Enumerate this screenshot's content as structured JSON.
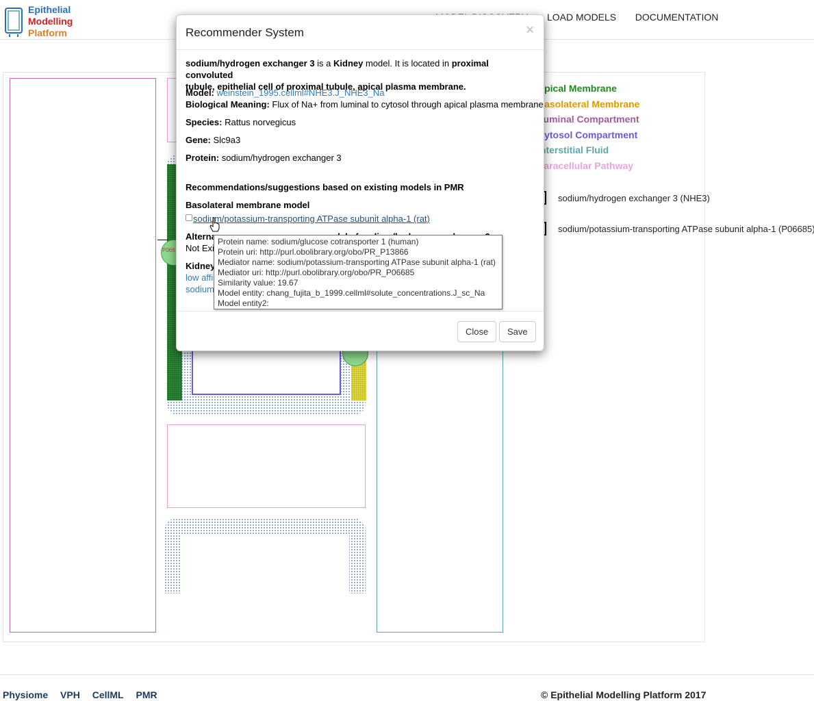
{
  "brand": {
    "line1": "Epithelial",
    "line2": "Modelling",
    "line3": "Platform"
  },
  "nav": {
    "items": [
      "MODEL DISCOVERY",
      "LOAD MODELS",
      "DOCUMENTATION"
    ]
  },
  "legend": {
    "items": [
      {
        "label": "Apical Membrane",
        "color": "#1e8a1e"
      },
      {
        "label": "Basolateral Membrane",
        "color": "#e09a00"
      },
      {
        "label": "Luminal Compartment",
        "color": "#a25aa0"
      },
      {
        "label": "Cytosol Compartment",
        "color": "#6a5ad6"
      },
      {
        "label": "Interstitial Fluid",
        "color": "#5aa8a8"
      },
      {
        "label": "Paracellular Pathway",
        "color": "#e6a6dc"
      }
    ]
  },
  "models": [
    {
      "label": "sodium/hydrogen exchanger 3 (NHE3)"
    },
    {
      "label": "sodium/potassium-transporting ATPase subunit alpha-1 (P06685)"
    }
  ],
  "diagram": {
    "transporter_label": "P066"
  },
  "modal": {
    "title": "Recommender System",
    "close_symbol": "×",
    "intro": {
      "name": "sodium/hydrogen exchanger 3",
      "is_a": " is a ",
      "organ": "Kidney",
      "located": " model. It is located in ",
      "location_line1": "proximal convoluted",
      "location_line2": "tubule, epithelial cell of proximal tubule, apical plasma membrane."
    },
    "model_label": "Model:",
    "model_link": "weinstein_1995.cellml#NHE3.J_NHE3_Na",
    "bio_label": "Biological Meaning:",
    "bio_value": "Flux of Na+ from luminal to cytosol through apical plasma membrane",
    "species_label": "Species:",
    "species_value": "Rattus norvegicus",
    "gene_label": "Gene:",
    "gene_value": "Slc9a3",
    "protein_label": "Protein:",
    "protein_value": "sodium/hydrogen exchanger 3",
    "recommendations_heading": "Recommendations/suggestions based on existing models in PMR",
    "basolateral_heading": "Basolateral membrane model",
    "basolateral_option": "sodium/potassium-transporting ATPase subunit alpha-1 (rat)",
    "alternative_heading_visible": "Alterna",
    "alternative_heading_tail": "model of sodium/hydrogen exchanger 3",
    "alternative_value_visible": "Not Exi",
    "kidney_heading_visible": "Kidney",
    "kidney_link1_visible": "low affi",
    "kidney_link2_visible": "sodium",
    "close_button": "Close",
    "save_button": "Save"
  },
  "tooltip": {
    "lines": [
      "Protein name: sodium/glucose cotransporter 1 (human)",
      "Protein uri: http://purl.obolibrary.org/obo/PR_P13866",
      "Mediator name: sodium/potassium-transporting ATPase subunit alpha-1 (rat)",
      "Mediator uri: http://purl.obolibrary.org/obo/PR_P06685",
      "Similarity value: 19.67",
      "Model entity: chang_fujita_b_1999.cellml#solute_concentrations.J_sc_Na",
      "Model entity2:"
    ]
  },
  "footer": {
    "links": [
      "Physiome",
      "VPH",
      "CellML",
      "PMR"
    ],
    "copyright": "© Epithelial Modelling Platform 2017"
  }
}
